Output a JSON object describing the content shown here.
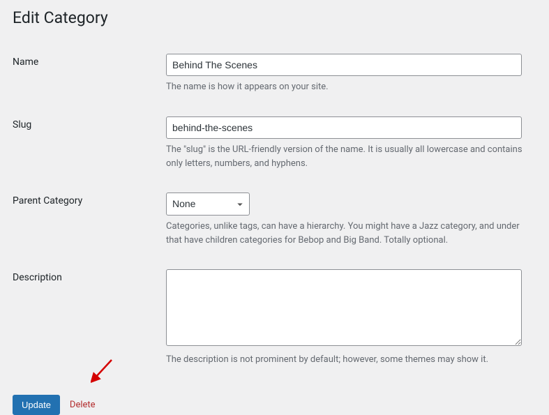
{
  "page_title": "Edit Category",
  "fields": {
    "name": {
      "label": "Name",
      "value": "Behind The Scenes",
      "hint": "The name is how it appears on your site."
    },
    "slug": {
      "label": "Slug",
      "value": "behind-the-scenes",
      "hint": "The \"slug\" is the URL-friendly version of the name. It is usually all lowercase and contains only letters, numbers, and hyphens."
    },
    "parent": {
      "label": "Parent Category",
      "selected": "None",
      "hint": "Categories, unlike tags, can have a hierarchy. You might have a Jazz category, and under that have children categories for Bebop and Big Band. Totally optional."
    },
    "description": {
      "label": "Description",
      "value": "",
      "hint": "The description is not prominent by default; however, some themes may show it."
    }
  },
  "actions": {
    "update_label": "Update",
    "delete_label": "Delete"
  },
  "annotation": {
    "arrow_color": "#d40000"
  }
}
